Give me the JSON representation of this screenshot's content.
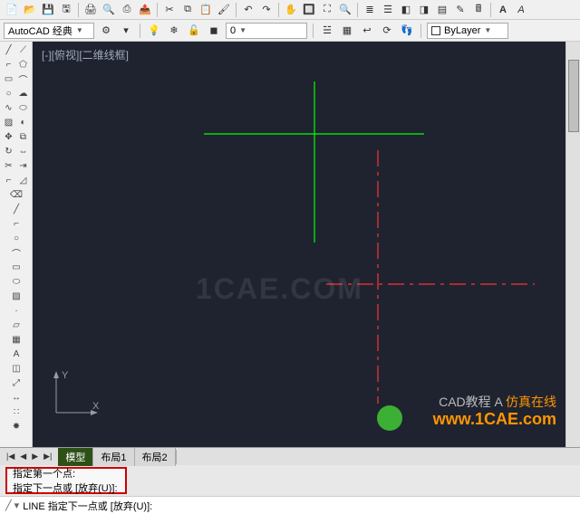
{
  "top_toolbar": {
    "icons": [
      "new",
      "open",
      "save",
      "saveall",
      "print",
      "print-preview",
      "plot",
      "publish",
      "cut",
      "copy",
      "paste",
      "match",
      "undo",
      "redo",
      "pan",
      "zoom-window",
      "zoom-extents",
      "zoom-realtime",
      "layer",
      "properties",
      "design-center",
      "tool-palettes",
      "sheet",
      "markup",
      "calc",
      "text-style"
    ]
  },
  "workspace": {
    "label": "AutoCAD 经典",
    "gear_icon": "gear",
    "layer_field": "0",
    "linetype": "ByLayer"
  },
  "left_palette": {
    "tools": [
      "line",
      "construction-line",
      "polyline",
      "polygon",
      "rectangle",
      "arc",
      "circle",
      "revision-cloud",
      "spline",
      "ellipse",
      "ellipse-arc",
      "insert-block",
      "make-block",
      "point",
      "hatch",
      "gradient",
      "region",
      "table",
      "text",
      "move",
      "copy",
      "stretch",
      "rotate",
      "mirror",
      "scale",
      "trim",
      "extend",
      "fillet",
      "chamfer",
      "array",
      "erase",
      "explode"
    ]
  },
  "viewport": {
    "label": "[-][俯视][二维线框]",
    "ucs_x": "X",
    "ucs_y": "Y"
  },
  "watermark": {
    "center": "1CAE.COM",
    "brand": "仿真在线",
    "url": "www.1CAE.com",
    "wechat_label": "CAD教程 A"
  },
  "tabs": {
    "nav": [
      "|◀",
      "◀",
      "▶",
      "▶|"
    ],
    "model": "模型",
    "layout1": "布局1",
    "layout2": "布局2"
  },
  "command": {
    "hist1": "指定第一个点:",
    "hist2": "指定下一点或 [放弃(U)]:",
    "prompt": "LINE 指定下一点或 [放弃(U)]:"
  },
  "chart_data": {
    "type": "line",
    "title": "",
    "series": [
      {
        "name": "green-horizontal",
        "color": "#00ff00",
        "points": [
          [
            225,
            102
          ],
          [
            468,
            102
          ]
        ]
      },
      {
        "name": "green-vertical",
        "color": "#00ff00",
        "points": [
          [
            347,
            44
          ],
          [
            347,
            222
          ]
        ]
      },
      {
        "name": "red-vertical",
        "color": "#ff3333",
        "dashed": true,
        "points": [
          [
            417,
            120
          ],
          [
            417,
            400
          ]
        ]
      },
      {
        "name": "red-horizontal",
        "color": "#ff3333",
        "dashed": true,
        "points": [
          [
            360,
            268
          ],
          [
            590,
            268
          ]
        ]
      }
    ]
  }
}
